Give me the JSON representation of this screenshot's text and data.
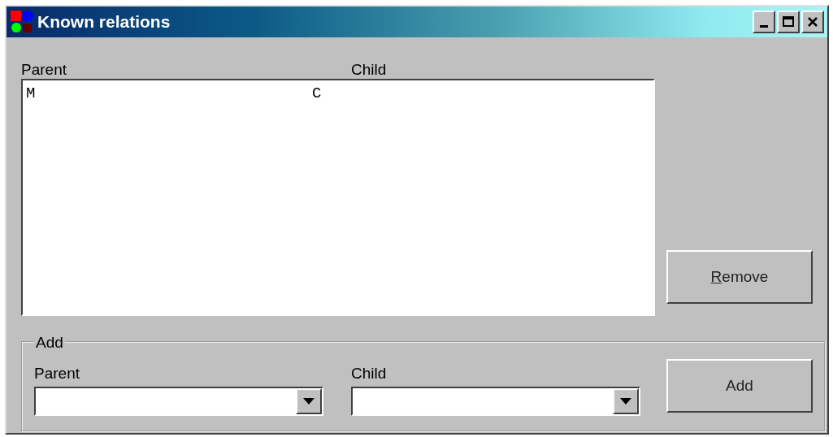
{
  "window": {
    "title": "Known relations",
    "controls": [
      {
        "kind": "minimize"
      },
      {
        "kind": "maximize"
      },
      {
        "kind": "close"
      }
    ]
  },
  "list": {
    "columns": [
      "Parent",
      "Child"
    ],
    "rows": [
      {
        "parent": "M",
        "child": "C"
      }
    ]
  },
  "remove_button": {
    "label": "Remove",
    "underlined_first_letter": true
  },
  "add_group": {
    "title": "Add",
    "fields": [
      {
        "label": "Parent"
      },
      {
        "label": "Child"
      }
    ],
    "button": {
      "label": "Add",
      "underlined_first_letter": false
    }
  }
}
